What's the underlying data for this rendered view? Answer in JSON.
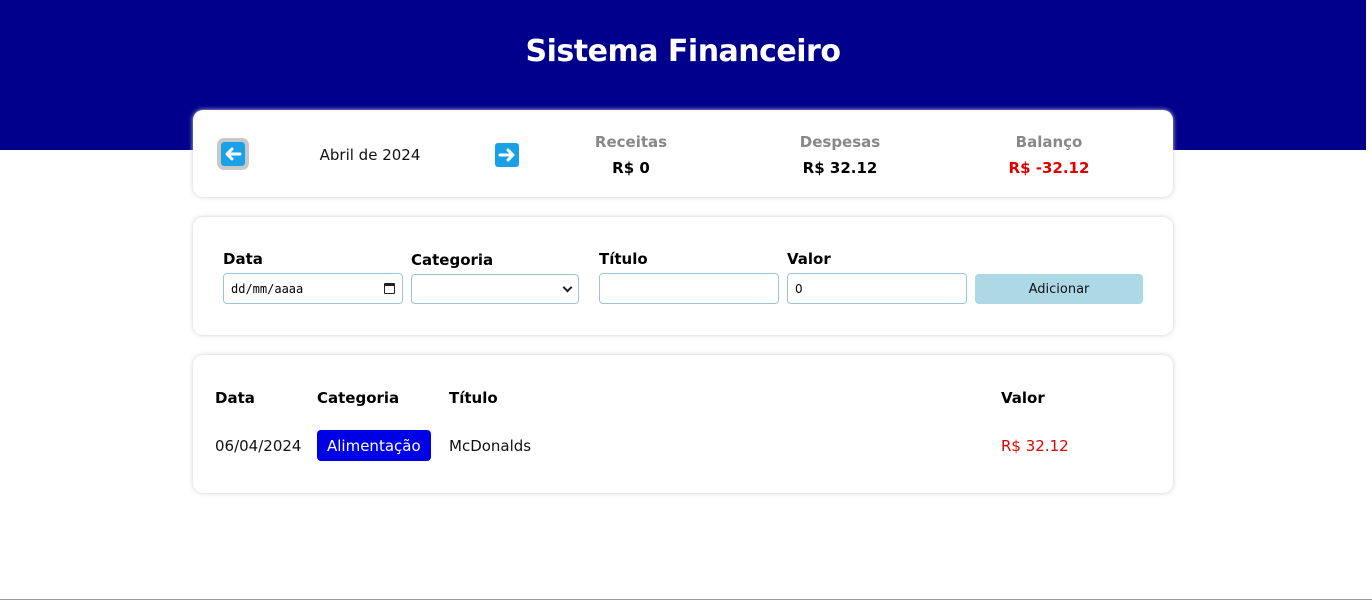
{
  "header": {
    "title": "Sistema Financeiro"
  },
  "info": {
    "month": "Abril de 2024",
    "income": {
      "title": "Receitas",
      "value": "R$ 0"
    },
    "expense": {
      "title": "Despesas",
      "value": "R$ 32.12"
    },
    "balance": {
      "title": "Balanço",
      "value": "R$ -32.12",
      "color": "#e00000"
    }
  },
  "form": {
    "date_label": "Data",
    "date_placeholder": "dd/mm/aaaa",
    "category_label": "Categoria",
    "category_value": "",
    "title_label": "Título",
    "title_value": "",
    "value_label": "Valor",
    "value_value": "0",
    "add_label": "Adicionar"
  },
  "table": {
    "headers": [
      "Data",
      "Categoria",
      "Título",
      "Valor"
    ],
    "rows": [
      {
        "date": "06/04/2024",
        "category": "Alimentação",
        "category_color": "#0000e6",
        "title": "McDonalds",
        "value": "R$ 32.12"
      }
    ]
  },
  "icons": {
    "prev": "arrow-left-icon",
    "next": "arrow-right-icon",
    "date": "calendar-icon",
    "select": "chevron-down-icon"
  },
  "colors": {
    "header_bg": "#00008c",
    "arrow_bg": "#19a0e6",
    "negative": "#e00000",
    "add_button": "#add8e6"
  }
}
